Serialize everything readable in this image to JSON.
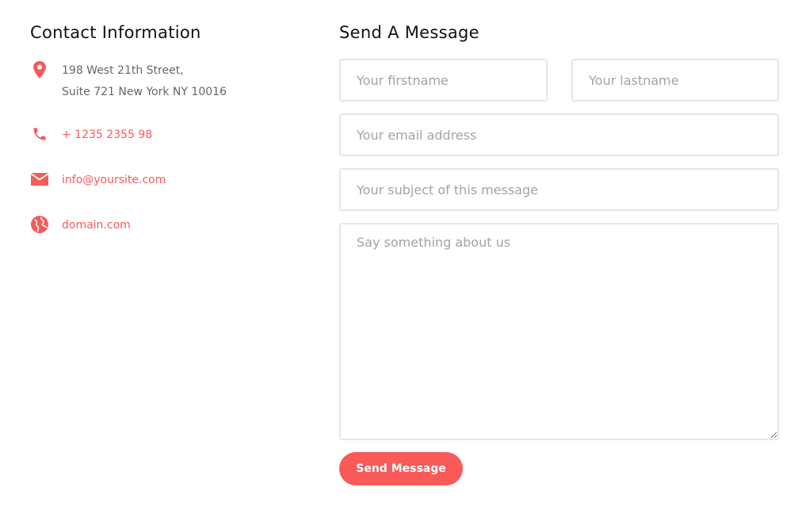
{
  "contact": {
    "title": "Contact Information",
    "address_line1": "198 West 21th Street,",
    "address_line2": "Suite 721 New York NY 10016",
    "phone": "+ 1235 2355 98",
    "email": "info@yoursite.com",
    "website": "domain.com",
    "icons": [
      "location-pin-icon",
      "phone-icon",
      "envelope-icon",
      "globe-icon"
    ],
    "accent_color": "#f85959"
  },
  "form": {
    "title": "Send A Message",
    "firstname_placeholder": "Your firstname",
    "lastname_placeholder": "Your lastname",
    "email_placeholder": "Your email address",
    "subject_placeholder": "Your subject of this message",
    "message_placeholder": "Say something about us",
    "submit_label": "Send Message"
  }
}
